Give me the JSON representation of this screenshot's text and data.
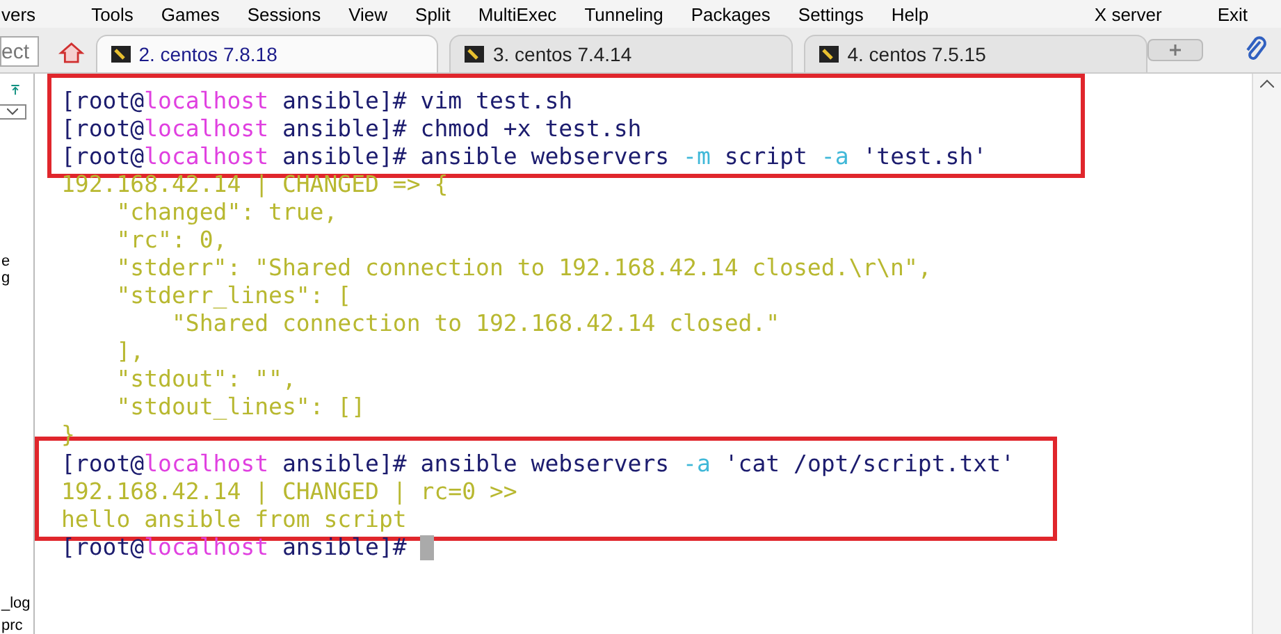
{
  "menu": [
    "vers",
    "Tools",
    "Games",
    "Sessions",
    "View",
    "Split",
    "MultiExec",
    "Tunneling",
    "Packages",
    "Settings",
    "Help",
    "X server",
    "Exit"
  ],
  "sidebar": {
    "search_placeholder": "ect",
    "items": [
      "e",
      "g",
      "_log",
      "prc"
    ]
  },
  "tabs": [
    {
      "label": "2. centos 7.8.18",
      "selected": true
    },
    {
      "label": "3. centos 7.4.14",
      "selected": false
    },
    {
      "label": "4. centos 7.5.15",
      "selected": false
    }
  ],
  "terminal": {
    "blocks": [
      {
        "highlighted": true,
        "lines": [
          [
            {
              "text": "[root@",
              "color": "#1c1c6e"
            },
            {
              "text": "localhost",
              "color": "#e040e0"
            },
            {
              "text": " ansible]# vim test.sh",
              "color": "#1c1c6e"
            }
          ],
          [
            {
              "text": "[root@",
              "color": "#1c1c6e"
            },
            {
              "text": "localhost",
              "color": "#e040e0"
            },
            {
              "text": " ansible]# chmod +x test.sh",
              "color": "#1c1c6e"
            }
          ],
          [
            {
              "text": "[root@",
              "color": "#1c1c6e"
            },
            {
              "text": "localhost",
              "color": "#e040e0"
            },
            {
              "text": " ansible]# ansible webservers ",
              "color": "#1c1c6e"
            },
            {
              "text": "-m",
              "color": "#40b8d8"
            },
            {
              "text": " script ",
              "color": "#1c1c6e"
            },
            {
              "text": "-a",
              "color": "#40b8d8"
            },
            {
              "text": " 'test.sh'",
              "color": "#1c1c6e"
            }
          ]
        ]
      },
      {
        "highlighted": false,
        "lines": [
          [
            {
              "text": "192.168.42.14 | CHANGED => {",
              "color": "#b8b830"
            }
          ],
          [
            {
              "text": "    \"changed\": true,",
              "color": "#b8b830"
            }
          ],
          [
            {
              "text": "    \"rc\": 0,",
              "color": "#b8b830"
            }
          ],
          [
            {
              "text": "    \"stderr\": \"Shared connection to 192.168.42.14 closed.\\r\\n\",",
              "color": "#b8b830"
            }
          ],
          [
            {
              "text": "    \"stderr_lines\": [",
              "color": "#b8b830"
            }
          ],
          [
            {
              "text": "        \"Shared connection to 192.168.42.14 closed.\"",
              "color": "#b8b830"
            }
          ],
          [
            {
              "text": "    ],",
              "color": "#b8b830"
            }
          ],
          [
            {
              "text": "    \"stdout\": \"\",",
              "color": "#b8b830"
            }
          ],
          [
            {
              "text": "    \"stdout_lines\": []",
              "color": "#b8b830"
            }
          ],
          [
            {
              "text": "}",
              "color": "#b8b830"
            }
          ]
        ]
      },
      {
        "highlighted": true,
        "lines": [
          [
            {
              "text": "[root@",
              "color": "#1c1c6e"
            },
            {
              "text": "localhost",
              "color": "#e040e0"
            },
            {
              "text": " ansible]# ansible webservers ",
              "color": "#1c1c6e"
            },
            {
              "text": "-a",
              "color": "#40b8d8"
            },
            {
              "text": " 'cat /opt/script.txt'",
              "color": "#1c1c6e"
            }
          ],
          [
            {
              "text": "192.168.42.14 | CHANGED | rc=0 >>",
              "color": "#b8b830"
            }
          ],
          [
            {
              "text": "hello ansible from script",
              "color": "#b8b830"
            }
          ]
        ]
      },
      {
        "highlighted": false,
        "cursor": true,
        "lines": [
          [
            {
              "text": "[root@",
              "color": "#1c1c6e"
            },
            {
              "text": "localhost",
              "color": "#e040e0"
            },
            {
              "text": " ansible]# ",
              "color": "#1c1c6e"
            }
          ]
        ]
      }
    ]
  }
}
